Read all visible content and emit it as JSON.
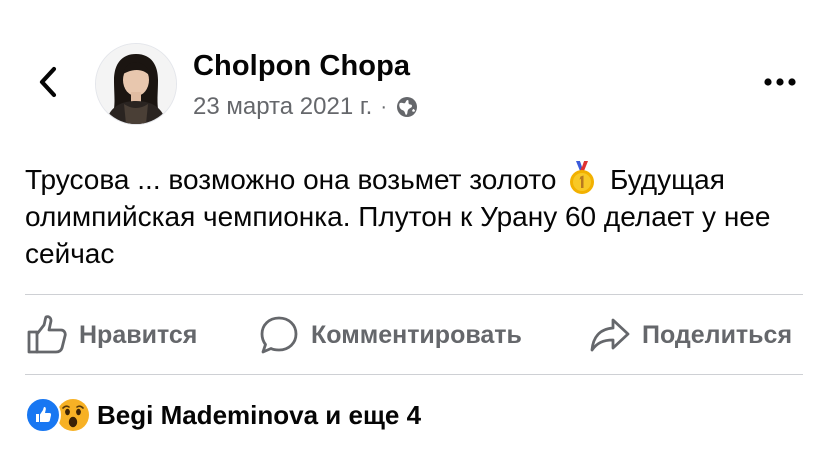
{
  "header": {
    "back_icon": "chevron-left-icon",
    "author_name": "Cholpon Chopa",
    "date": "23 марта 2021 г.",
    "separator": "·",
    "privacy_icon": "globe-icon",
    "more_icon": "more-horizontal-icon"
  },
  "post": {
    "text_before_emoji": "Трусова ... возможно она возьмет золото",
    "emoji": "1st-place-medal-icon",
    "text_after_emoji": "Будущая олимпийская чемпионка. Плутон к Урану 60 делает у нее сейчас"
  },
  "actions": {
    "like_label": "Нравится",
    "comment_label": "Комментировать",
    "share_label": "Поделиться"
  },
  "reactions": {
    "icons": [
      "like-reaction-icon",
      "wow-reaction-icon"
    ],
    "summary": "Begi Mademinova и еще 4"
  },
  "colors": {
    "text": "#050505",
    "secondary_text": "#65676b",
    "divider": "#ced0d4",
    "like_blue": "#1877f2",
    "wow_yellow": "#f7b125"
  }
}
